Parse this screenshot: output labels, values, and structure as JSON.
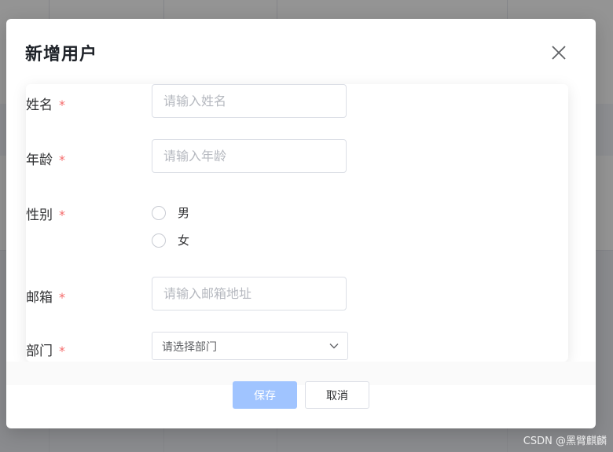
{
  "dialog": {
    "title": "新增用户",
    "close_icon": "close-icon"
  },
  "form": {
    "required_mark": "*",
    "name": {
      "label": "姓名",
      "placeholder": "请输入姓名"
    },
    "age": {
      "label": "年龄",
      "placeholder": "请输入年龄"
    },
    "gender": {
      "label": "性别",
      "options": [
        "男",
        "女"
      ]
    },
    "email": {
      "label": "邮箱",
      "placeholder": "请输入邮箱地址"
    },
    "department": {
      "label": "部门",
      "placeholder": "请选择部门",
      "icon": "chevron-down-icon"
    }
  },
  "footer": {
    "save_label": "保存",
    "cancel_label": "取消"
  },
  "watermark": "CSDN @黑臂麒麟",
  "colors": {
    "required": "#f56c6c",
    "primary_disabled": "#a0c4ff",
    "border": "#dcdfe6"
  }
}
